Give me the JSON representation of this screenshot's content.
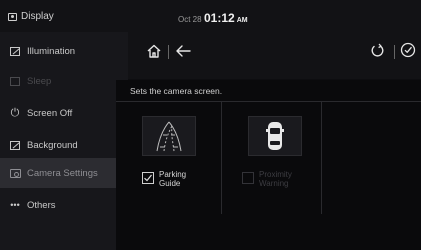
{
  "status": {
    "title": "Display",
    "date": "Oct 28",
    "time": "01:12",
    "ampm": "AM"
  },
  "sidebar": {
    "items": [
      {
        "label": "Illumination",
        "icon": "illumination-icon",
        "state": "normal"
      },
      {
        "label": "Sleep",
        "icon": "sleep-icon",
        "state": "disabled"
      },
      {
        "label": "Screen Off",
        "icon": "power-icon",
        "state": "normal"
      },
      {
        "label": "Background",
        "icon": "background-icon",
        "state": "normal"
      },
      {
        "label": "Camera Settings",
        "icon": "camera-icon",
        "state": "active"
      },
      {
        "label": "Others",
        "icon": "more-icon",
        "state": "normal"
      }
    ]
  },
  "dialog": {
    "title": "Sets the camera screen.",
    "options": [
      {
        "line1": "Parking",
        "line2": "Guide",
        "checked": true,
        "enabled": true,
        "icon": "parking-guide-icon"
      },
      {
        "line1": "Proximity",
        "line2": "Warning",
        "checked": false,
        "enabled": false,
        "icon": "proximity-warning-icon"
      }
    ]
  },
  "colors": {
    "background": "#0d0d10",
    "sidebar": "#17171b",
    "active_item": "#2c2c31",
    "text": "#d8d8d8",
    "disabled_text": "#3d3d42"
  }
}
